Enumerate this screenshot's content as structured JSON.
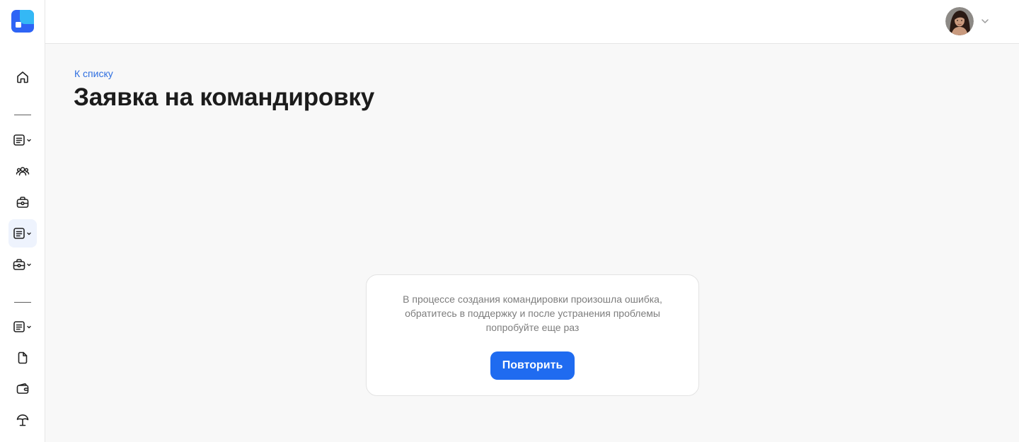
{
  "app": {
    "logo_icon": "app-logo-icon",
    "colors": {
      "logo_primary": "#2e64f5",
      "logo_accent": "#34b8f5",
      "accent": "#1f6bf0",
      "link": "#2f6fe0"
    }
  },
  "sidebar": {
    "items": [
      {
        "name": "home",
        "icon": "home-icon",
        "has_dropdown": false,
        "active": false
      },
      {
        "name": "documents-1",
        "icon": "document-list-icon",
        "has_dropdown": true,
        "active": false
      },
      {
        "name": "people",
        "icon": "users-icon",
        "has_dropdown": false,
        "active": false
      },
      {
        "name": "trips",
        "icon": "briefcase-icon",
        "has_dropdown": false,
        "active": false
      },
      {
        "name": "documents-2",
        "icon": "document-list-icon",
        "has_dropdown": true,
        "active": true
      },
      {
        "name": "trips-2",
        "icon": "briefcase-icon",
        "has_dropdown": true,
        "active": false
      },
      {
        "name": "documents-3",
        "icon": "document-list-icon",
        "has_dropdown": true,
        "active": false
      },
      {
        "name": "files",
        "icon": "file-icon",
        "has_dropdown": false,
        "active": false
      },
      {
        "name": "wallet",
        "icon": "wallet-icon",
        "has_dropdown": false,
        "active": false
      },
      {
        "name": "vacation",
        "icon": "umbrella-icon",
        "has_dropdown": false,
        "active": false
      }
    ]
  },
  "header": {
    "user_avatar_icon": "user-avatar",
    "menu_icon": "chevron-down-icon"
  },
  "main": {
    "back_link": "К списку",
    "title": "Заявка на командировку",
    "error": {
      "message": "В процессе создания командировки произошла ошибка, обратитесь в поддержку и после устранения проблемы попробуйте еще раз",
      "retry_label": "Повторить"
    }
  }
}
